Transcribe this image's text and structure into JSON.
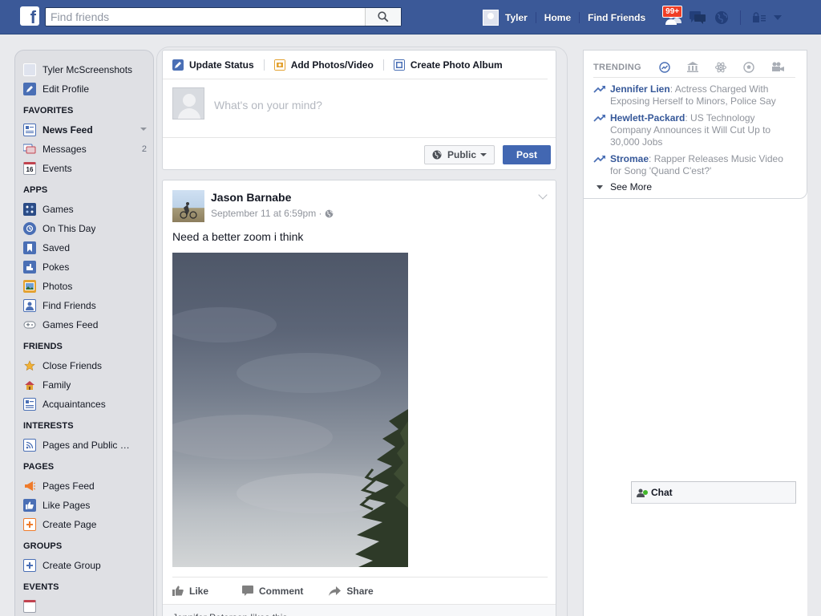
{
  "topbar": {
    "logo": "f",
    "search_placeholder": "Find friends",
    "user_name": "Tyler",
    "nav": [
      "Home",
      "Find Friends"
    ],
    "friend_requests_badge": "99+",
    "colors": {
      "brand": "#3b5998",
      "badge": "#f03d25"
    }
  },
  "sidebar": {
    "profile_name": "Tyler McScreenshots",
    "edit_profile": "Edit Profile",
    "sections": {
      "favorites": "FAVORITES",
      "apps": "APPS",
      "friends": "FRIENDS",
      "interests": "INTERESTS",
      "pages": "PAGES",
      "groups": "GROUPS",
      "events": "EVENTS"
    },
    "favorites": [
      {
        "label": "News Feed",
        "icon": "news-feed-icon"
      },
      {
        "label": "Messages",
        "count": "2",
        "icon": "messages-icon"
      },
      {
        "label": "Events",
        "icon": "calendar-icon",
        "icon_text": "16"
      }
    ],
    "apps": [
      {
        "label": "Games",
        "icon": "games-icon"
      },
      {
        "label": "On This Day",
        "icon": "on-this-day-icon"
      },
      {
        "label": "Saved",
        "icon": "bookmark-icon"
      },
      {
        "label": "Pokes",
        "icon": "pokes-icon"
      },
      {
        "label": "Photos",
        "icon": "photos-icon"
      },
      {
        "label": "Find Friends",
        "icon": "find-friends-icon"
      },
      {
        "label": "Games Feed",
        "icon": "games-feed-icon"
      }
    ],
    "friends": [
      {
        "label": "Close Friends",
        "icon": "star-icon"
      },
      {
        "label": "Family",
        "icon": "house-icon"
      },
      {
        "label": "Acquaintances",
        "icon": "acquaintances-icon"
      }
    ],
    "interests": [
      {
        "label": "Pages and Public …",
        "icon": "rss-icon"
      }
    ],
    "pages": [
      {
        "label": "Pages Feed",
        "icon": "megaphone-icon"
      },
      {
        "label": "Like Pages",
        "icon": "thumbs-up-icon"
      },
      {
        "label": "Create Page",
        "icon": "plus-icon"
      }
    ],
    "groups": [
      {
        "label": "Create Group",
        "icon": "plus-icon"
      }
    ]
  },
  "composer": {
    "tabs": [
      "Update Status",
      "Add Photos/Video",
      "Create Photo Album"
    ],
    "placeholder": "What's on your mind?",
    "privacy": "Public",
    "post_button": "Post"
  },
  "post": {
    "author": "Jason Barnabe",
    "timestamp": "September 11 at 6:59pm ·",
    "text": "Need a better zoom i think",
    "actions": [
      "Like",
      "Comment",
      "Share"
    ],
    "likes_text": "Jennifer Peterson likes this."
  },
  "trending": {
    "title": "TRENDING",
    "items": [
      {
        "topic": "Jennifer Lien",
        "desc": ": Actress Charged With Exposing Herself to Minors, Police Say"
      },
      {
        "topic": "Hewlett-Packard",
        "desc": ": US Technology Company Announces it Will Cut Up to 30,000 Jobs"
      },
      {
        "topic": "Stromae",
        "desc": ": Rapper Releases Music Video for Song 'Quand C'est?'"
      }
    ],
    "see_more": "See More"
  },
  "chat": {
    "label": "Chat"
  }
}
